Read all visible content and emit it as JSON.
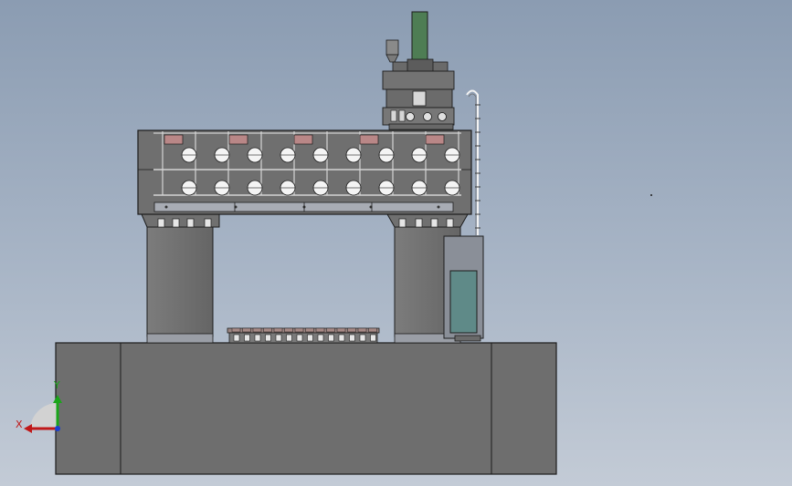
{
  "viewport": {
    "background_top": "#8b9cb2",
    "background_bottom": "#c3cbd6"
  },
  "model": {
    "body_color": "#6e6e6e",
    "edge_color": "#1c1c1c",
    "column_color": "#727272",
    "spindle_color": "#4e7d54",
    "pad_color": "#b98787",
    "panel_screen_color": "#5f8a88"
  },
  "triad": {
    "x_label": "X",
    "y_label": "Y",
    "x_color": "#c01818",
    "y_color": "#1aa51a",
    "z_color": "#1a3fd0"
  }
}
